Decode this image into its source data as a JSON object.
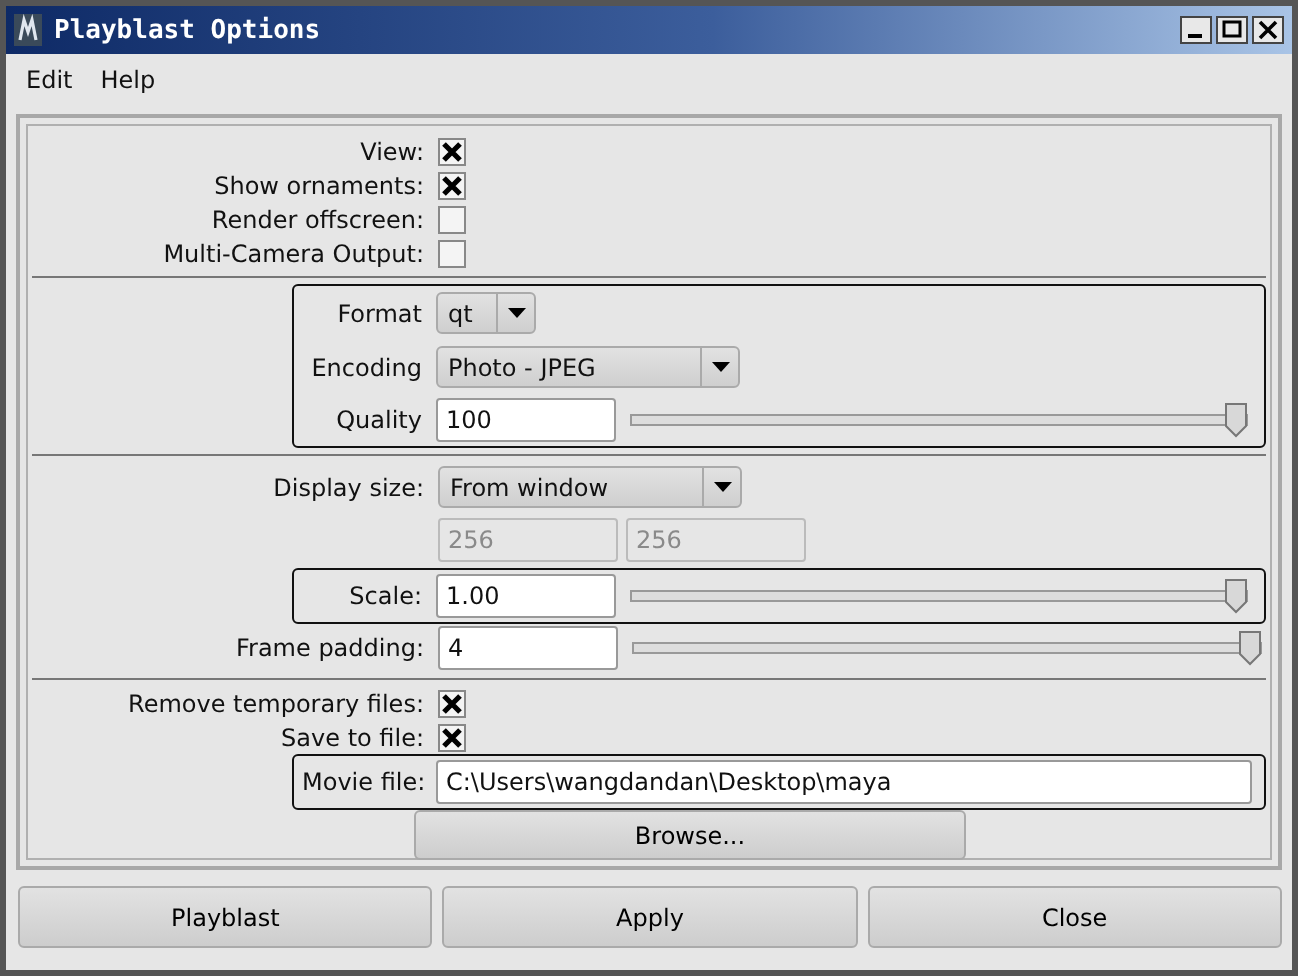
{
  "window": {
    "title": "Playblast Options"
  },
  "menu": [
    "Edit",
    "Help"
  ],
  "sections": [
    {
      "items": [
        {
          "kind": "checkbox",
          "label": "View:",
          "checked": true
        },
        {
          "kind": "checkbox",
          "label": "Show ornaments:",
          "checked": true
        },
        {
          "kind": "checkbox",
          "label": "Render offscreen:",
          "checked": false
        },
        {
          "kind": "checkbox",
          "label": "Multi-Camera Output:",
          "checked": false
        }
      ]
    },
    {
      "items": [
        {
          "kind": "frame",
          "rows": [
            {
              "kind": "dropdown",
              "label": "Format",
              "value": "qt"
            },
            {
              "kind": "dropdown",
              "label": "Encoding",
              "value": "Photo - JPEG"
            },
            {
              "kind": "slider",
              "label": "Quality",
              "value": "100",
              "level": 1
            }
          ]
        }
      ]
    },
    {
      "items": [
        {
          "kind": "dropdown",
          "label": "Display size:",
          "value": "From window"
        },
        {
          "kind": "pair",
          "values": [
            "256",
            "256"
          ],
          "disabled": true
        },
        {
          "kind": "frame",
          "rows": [
            {
              "kind": "slider",
              "label": "Scale:",
              "value": "1.00",
              "level": 1
            }
          ]
        },
        {
          "kind": "slider",
          "label": "Frame padding:",
          "value": "4",
          "level": 1
        }
      ]
    },
    {
      "items": [
        {
          "kind": "checkbox",
          "label": "Remove temporary files:",
          "checked": true
        },
        {
          "kind": "checkbox",
          "label": "Save to file:",
          "checked": true
        },
        {
          "kind": "frame",
          "rows": [
            {
              "kind": "path",
              "label": "Movie file:",
              "value": "C:\\Users\\wangdandan\\Desktop\\maya"
            }
          ]
        },
        {
          "kind": "button",
          "label": "Browse..."
        }
      ]
    }
  ],
  "buttons": [
    "Playblast",
    "Apply",
    "Close"
  ]
}
